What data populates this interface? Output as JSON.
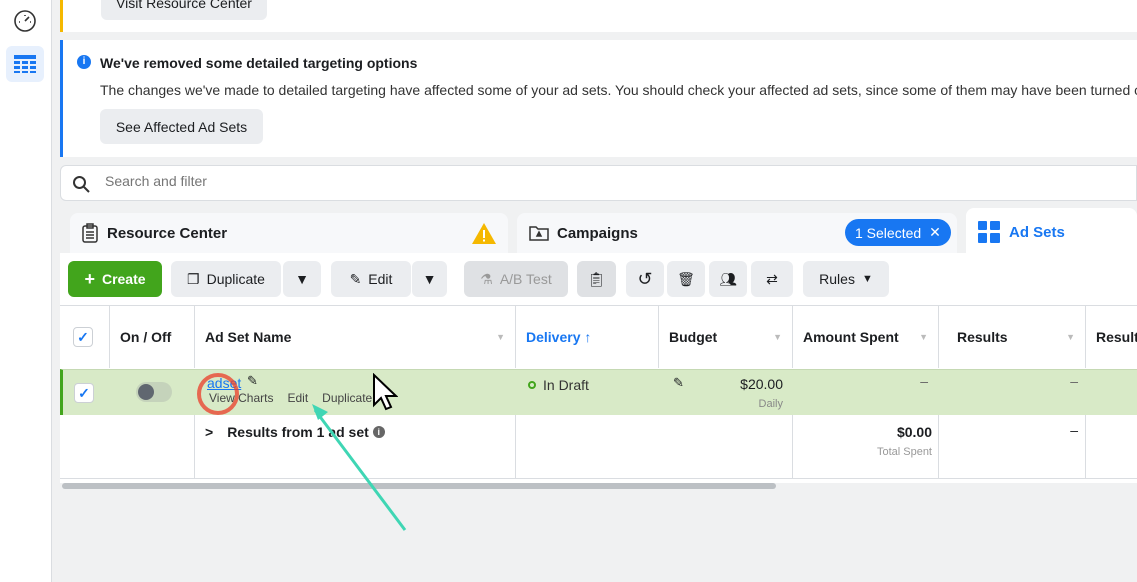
{
  "top_card": {
    "button": "Visit Resource Center"
  },
  "notice": {
    "title": "We've removed some detailed targeting options",
    "body": "The changes we've made to detailed targeting have affected some of your ad sets. You should check your affected ad sets, since some of them may have been turned off.",
    "button": "See Affected Ad Sets"
  },
  "search": {
    "placeholder": "Search and filter"
  },
  "tabs": [
    {
      "label": "Resource Center"
    },
    {
      "label": "Campaigns",
      "badge": "1 Selected"
    },
    {
      "label": "Ad Sets"
    }
  ],
  "toolbar": {
    "create": "Create",
    "duplicate": "Duplicate",
    "edit": "Edit",
    "ab_test": "A/B Test",
    "rules": "Rules"
  },
  "table": {
    "columns": [
      "On / Off",
      "Ad Set Name",
      "Delivery",
      "Budget",
      "Amount Spent",
      "Results",
      "Result"
    ],
    "row": {
      "name": "adset",
      "actions": [
        "View Charts",
        "Edit",
        "Duplicate"
      ],
      "delivery": "In Draft",
      "budget": "$20.00",
      "budget_type": "Daily",
      "amount_spent": "–",
      "results": "–"
    },
    "summary": {
      "label": "Results from 1 ad set",
      "amount_spent": "$0.00",
      "amount_label": "Total Spent",
      "results": "–"
    }
  },
  "colors": {
    "accent": "#1877f2",
    "create": "#42a51c",
    "row_selected": "#d8eac7",
    "warning": "#f5b800"
  }
}
